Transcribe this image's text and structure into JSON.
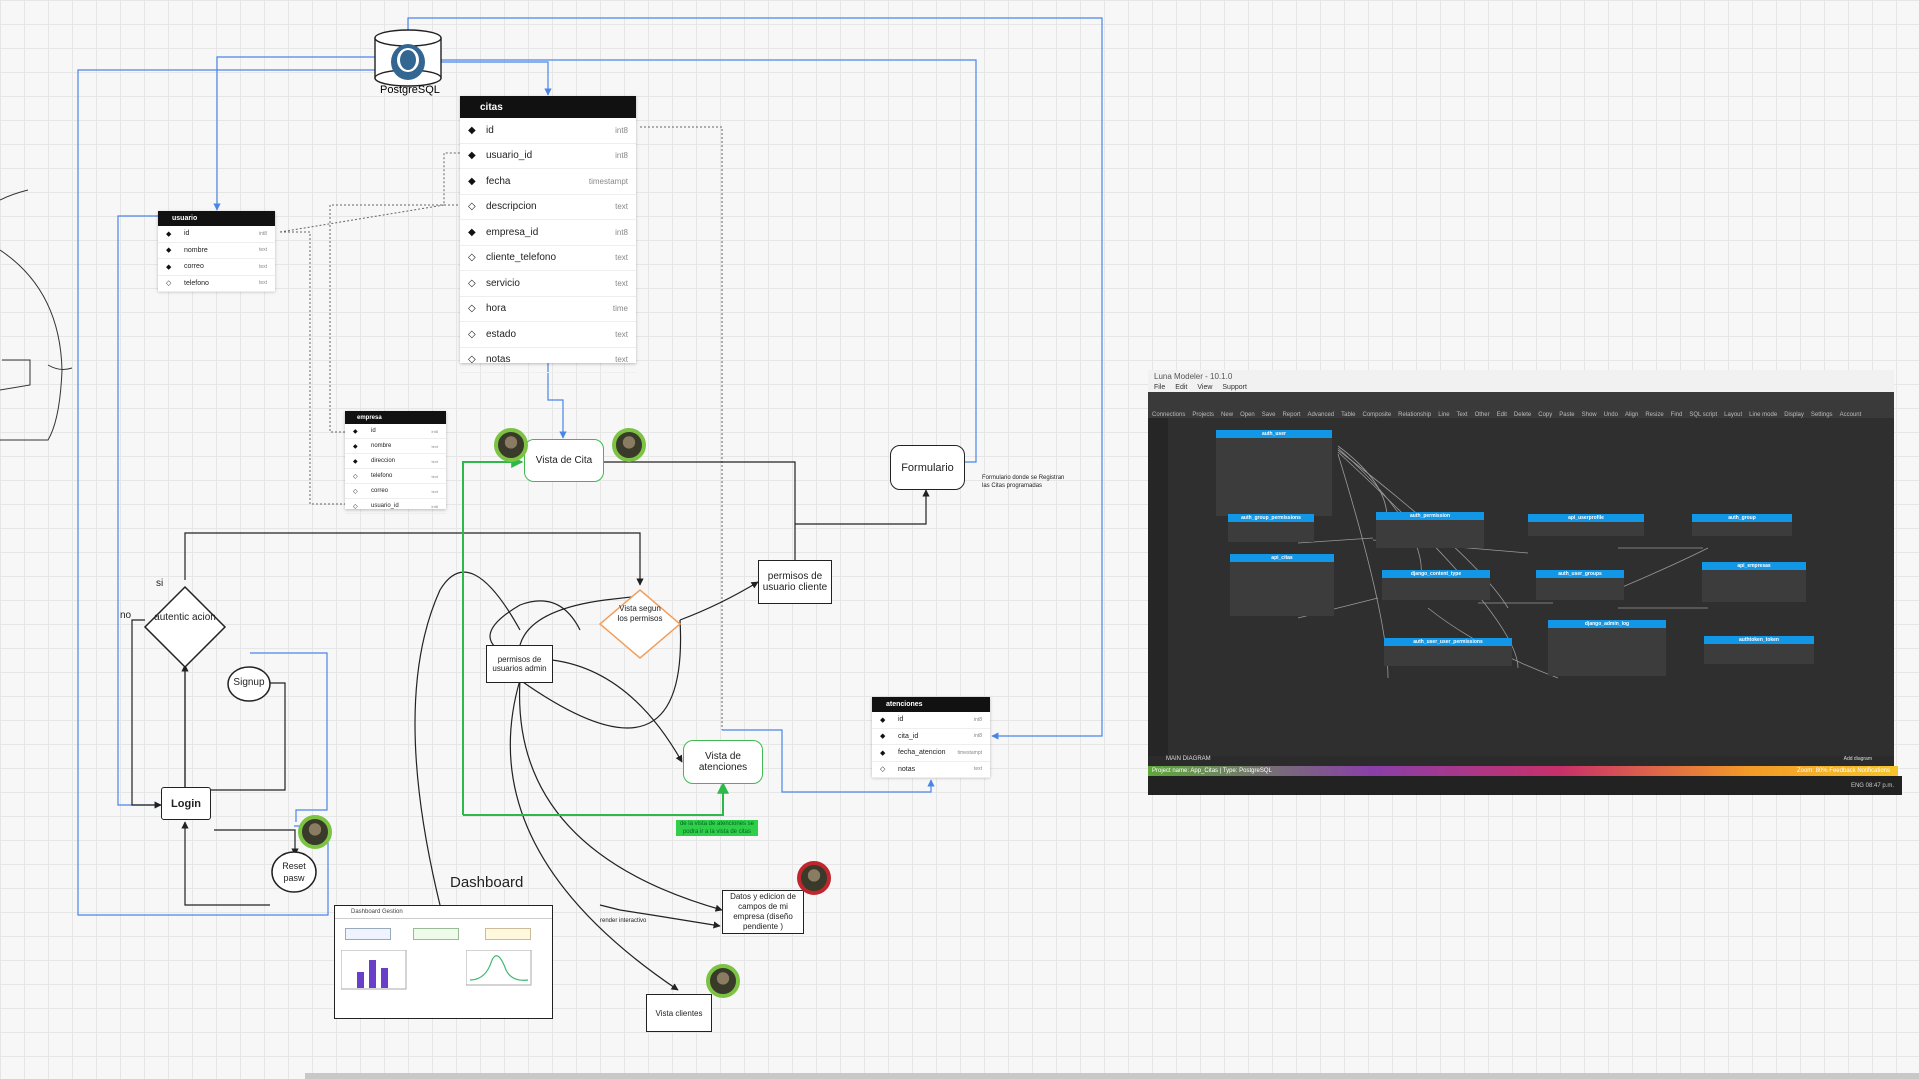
{
  "postgres": {
    "label": "PostgreSQL"
  },
  "tables": {
    "citas": {
      "name": "citas",
      "rows": [
        {
          "name": "id",
          "type": "int8"
        },
        {
          "name": "usuario_id",
          "type": "int8"
        },
        {
          "name": "fecha",
          "type": "timestampt"
        },
        {
          "name": "descripcion",
          "type": "text"
        },
        {
          "name": "empresa_id",
          "type": "int8"
        },
        {
          "name": "cliente_telefono",
          "type": "text"
        },
        {
          "name": "servicio",
          "type": "text"
        },
        {
          "name": "hora",
          "type": "time"
        },
        {
          "name": "estado",
          "type": "text"
        },
        {
          "name": "notas",
          "type": "text"
        }
      ]
    },
    "usuario": {
      "name": "usuario",
      "rows": [
        {
          "name": "id",
          "type": "int8"
        },
        {
          "name": "nombre",
          "type": "text"
        },
        {
          "name": "correo",
          "type": "text"
        },
        {
          "name": "telefono",
          "type": "text"
        }
      ]
    },
    "empresa": {
      "name": "empresa",
      "rows": [
        {
          "name": "id",
          "type": "int8"
        },
        {
          "name": "nombre",
          "type": "text"
        },
        {
          "name": "direccion",
          "type": "text"
        },
        {
          "name": "telefono",
          "type": "text"
        },
        {
          "name": "correo",
          "type": "text"
        },
        {
          "name": "usuario_id",
          "type": "int8"
        }
      ]
    },
    "atenciones": {
      "name": "atenciones",
      "rows": [
        {
          "name": "id",
          "type": "int8"
        },
        {
          "name": "cita_id",
          "type": "int8"
        },
        {
          "name": "fecha_atencion",
          "type": "timestampt"
        },
        {
          "name": "notas",
          "type": "text"
        }
      ]
    }
  },
  "flow": {
    "vista_cita": "Vista de Cita",
    "formulario": "Formulario",
    "formulario_note": "Formulario donde se Registran las Citas programadas",
    "permisos_cliente": "permisos de usuario cliente",
    "vista_segun": "Vista segun los permisos",
    "permisos_admin": "permisos de usuarios admin",
    "vista_atenciones": "Vista de atenciones",
    "green_note": "de la vista de atenciones se podra ir a la vista de citas",
    "datos_empresa": "Datos y edicion de campos de mi empresa (diseño pendiente )",
    "vista_clientes": "Vista clientes",
    "dashboard_title": "Dashboard",
    "dashboard_inner": "Dashboard Gestion",
    "render_note": "render interactivo",
    "autenticacion": "autentic acion",
    "si": "si",
    "no": "no",
    "signup": "Signup",
    "login": "Login",
    "reset": "Reset pasw"
  },
  "screenshot": {
    "title": "Luna Modeler - 10.1.0",
    "menu": [
      "File",
      "Edit",
      "View",
      "Support"
    ],
    "tools": [
      "Connections",
      "Projects",
      "New",
      "Open",
      "Save",
      "Report",
      "Advanced",
      "Table",
      "Composite",
      "Relationship",
      "Line",
      "Text",
      "Other",
      "Edit",
      "Delete",
      "Copy",
      "Paste",
      "Show",
      "Undo",
      "Align",
      "Resize",
      "Find",
      "SQL script",
      "Layout",
      "Line mode",
      "Display",
      "Settings",
      "Account"
    ],
    "tables": [
      "auth_user",
      "auth_group_permissions",
      "auth_permission",
      "api_userprofile",
      "auth_group",
      "api_citas",
      "django_content_type",
      "auth_user_groups",
      "api_empresas",
      "auth_user_user_permissions",
      "django_admin_log",
      "authtoken_token"
    ],
    "tab": "MAIN DIAGRAM",
    "add_diagram": "Add diagram",
    "status_left": "Project name: App_Citas   |  Type: PostgreSQL",
    "status_right": "Zoom: 80%     Feedback     Notifications",
    "clock": "ENG   08:47 p.m."
  },
  "colors": {
    "blue_line": "#4a86e8",
    "green_line": "#2fb84a",
    "orange": "#f0a060",
    "db_header": "#111111",
    "entity_header": "#1296e6"
  }
}
